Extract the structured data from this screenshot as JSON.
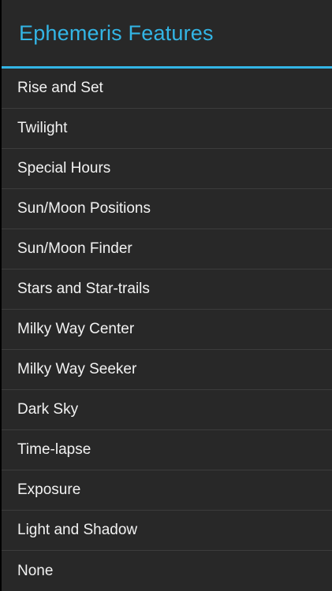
{
  "dialog": {
    "title": "Ephemeris Features",
    "accent_color": "#33b5e5",
    "background_color": "#282828",
    "options": [
      {
        "label": "Rise and Set"
      },
      {
        "label": "Twilight"
      },
      {
        "label": "Special Hours"
      },
      {
        "label": "Sun/Moon Positions"
      },
      {
        "label": "Sun/Moon Finder"
      },
      {
        "label": "Stars and Star-trails"
      },
      {
        "label": "Milky Way Center"
      },
      {
        "label": "Milky Way Seeker"
      },
      {
        "label": "Dark Sky"
      },
      {
        "label": "Time-lapse"
      },
      {
        "label": "Exposure"
      },
      {
        "label": "Light and Shadow"
      },
      {
        "label": "None"
      }
    ]
  }
}
